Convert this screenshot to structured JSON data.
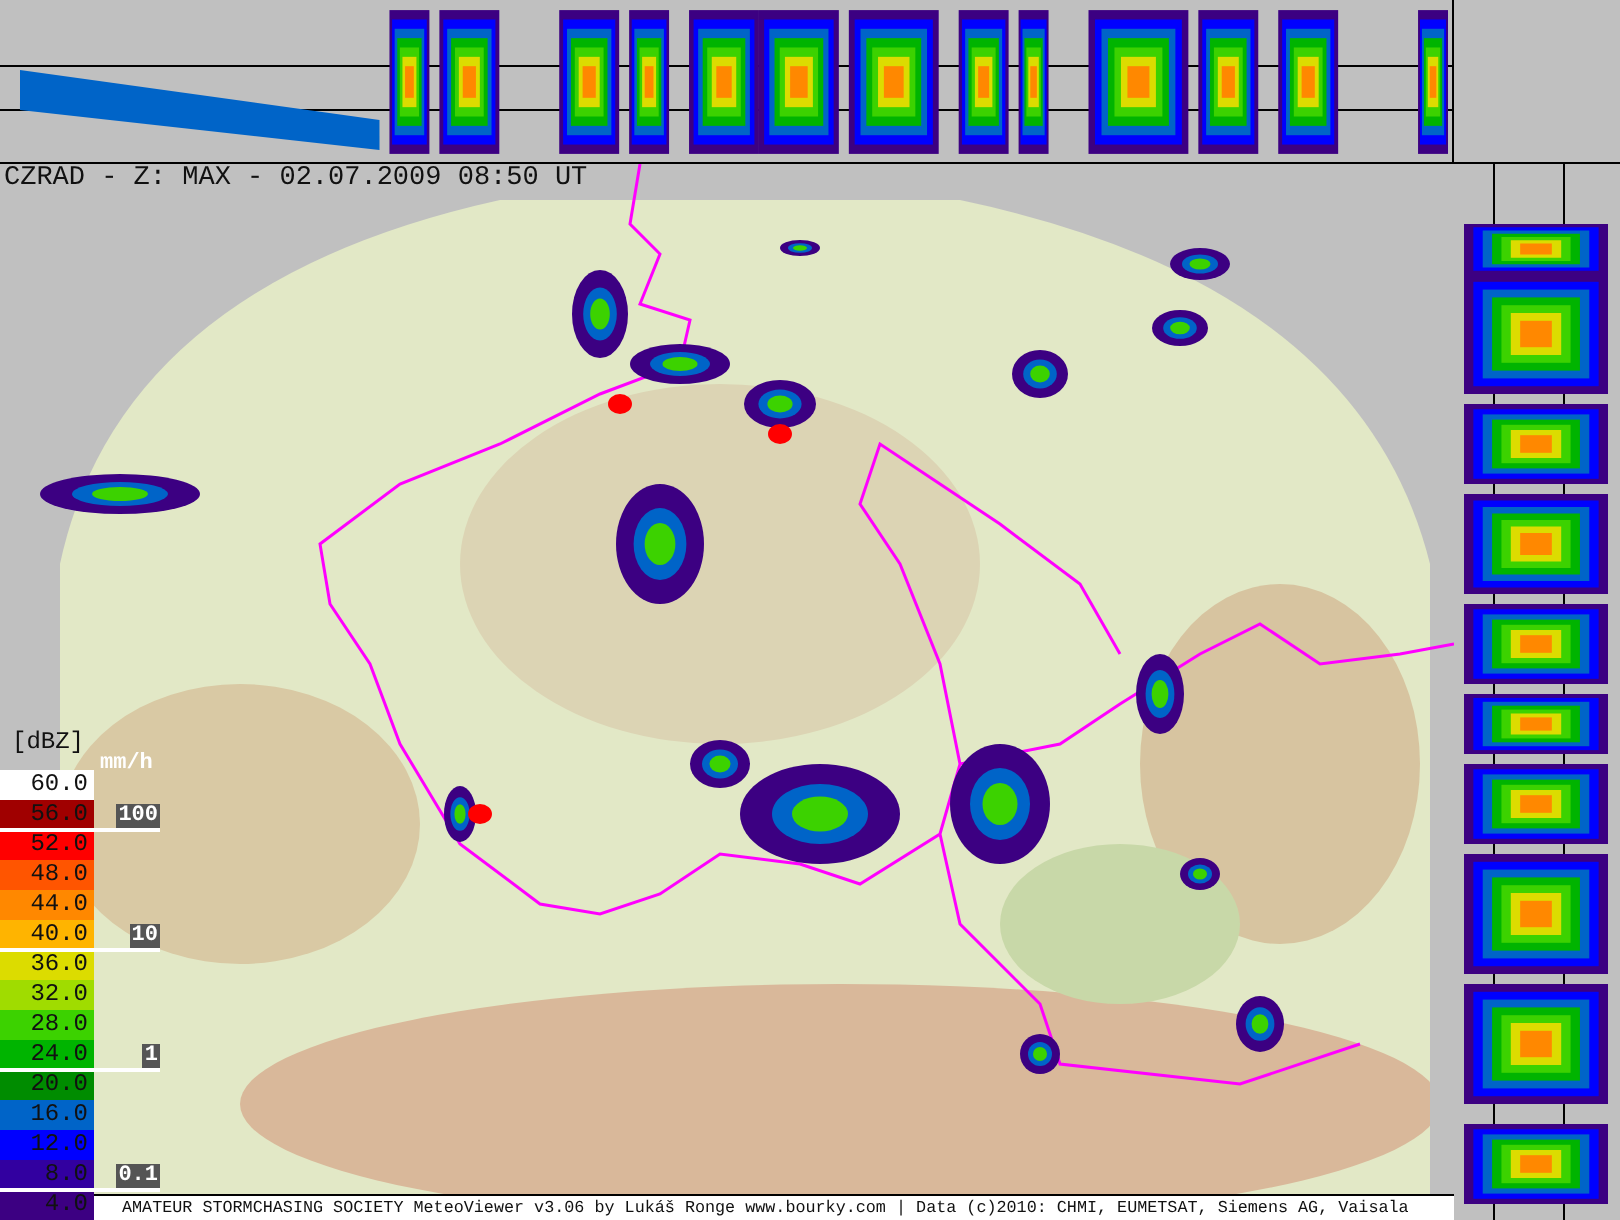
{
  "title": "CZRAD - Z: MAX - 02.07.2009 08:50 UT",
  "legend": {
    "unit": "[dBZ]",
    "rate_unit": "mm/h",
    "entries": [
      {
        "label": "60.0",
        "color": "#ffffff"
      },
      {
        "label": "56.0",
        "color": "#a00000"
      },
      {
        "label": "52.0",
        "color": "#ff0000"
      },
      {
        "label": "48.0",
        "color": "#ff5500"
      },
      {
        "label": "44.0",
        "color": "#ff8800"
      },
      {
        "label": "40.0",
        "color": "#ffb400"
      },
      {
        "label": "36.0",
        "color": "#dcdc00"
      },
      {
        "label": "32.0",
        "color": "#a0dc00"
      },
      {
        "label": "28.0",
        "color": "#3cd200"
      },
      {
        "label": "24.0",
        "color": "#00b400"
      },
      {
        "label": "20.0",
        "color": "#008c00"
      },
      {
        "label": "16.0",
        "color": "#0064c8"
      },
      {
        "label": "12.0",
        "color": "#0000ff"
      },
      {
        "label": "8.0",
        "color": "#3200a0"
      },
      {
        "label": "4.0",
        "color": "#3c0082"
      }
    ],
    "rate_marks": [
      {
        "label": "100"
      },
      {
        "label": "10"
      },
      {
        "label": "1"
      },
      {
        "label": "0.1"
      }
    ]
  },
  "footer": "AMATEUR STORMCHASING SOCIETY MeteoViewer v3.06 by Lukáš Ronge www.bourky.com | Data (c)2010: CHMI, EUMETSAT, Siemens AG, Vaisala"
}
